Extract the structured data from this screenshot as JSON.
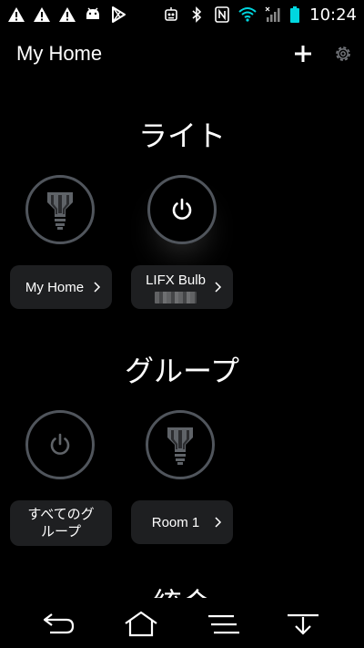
{
  "status_bar": {
    "left_icons": [
      "warning-icon",
      "warning-icon",
      "warning-icon",
      "android-icon",
      "play-store-icon"
    ],
    "right_icons": [
      "robot-icon",
      "bluetooth-icon",
      "nfc-icon",
      "wifi-icon",
      "signal-icon",
      "battery-icon"
    ],
    "time": "10:24"
  },
  "header": {
    "title": "My Home",
    "add_icon": "plus-icon",
    "settings_icon": "gear-icon"
  },
  "sections": {
    "lights": {
      "title": "ライト",
      "items": [
        {
          "label": "My Home",
          "icon": "bulb-icon",
          "state": "off"
        },
        {
          "label": "LIFX Bulb",
          "icon": "power-icon",
          "state": "on"
        }
      ]
    },
    "groups": {
      "title": "グループ",
      "items": [
        {
          "label": "すべてのグ\nループ",
          "icon": "power-icon",
          "state": "off"
        },
        {
          "label": "Room 1",
          "icon": "bulb-icon",
          "state": "off"
        }
      ]
    },
    "next_title_partial": "統合"
  },
  "nav_bar": {
    "buttons": [
      "back-icon",
      "home-icon",
      "menu-icon",
      "hide-keyboard-icon"
    ]
  },
  "colors": {
    "background": "#000000",
    "ring": "#50555c",
    "pill": "#1e1f21",
    "text": "#ffffff",
    "icon_dim": "#5f6368"
  }
}
